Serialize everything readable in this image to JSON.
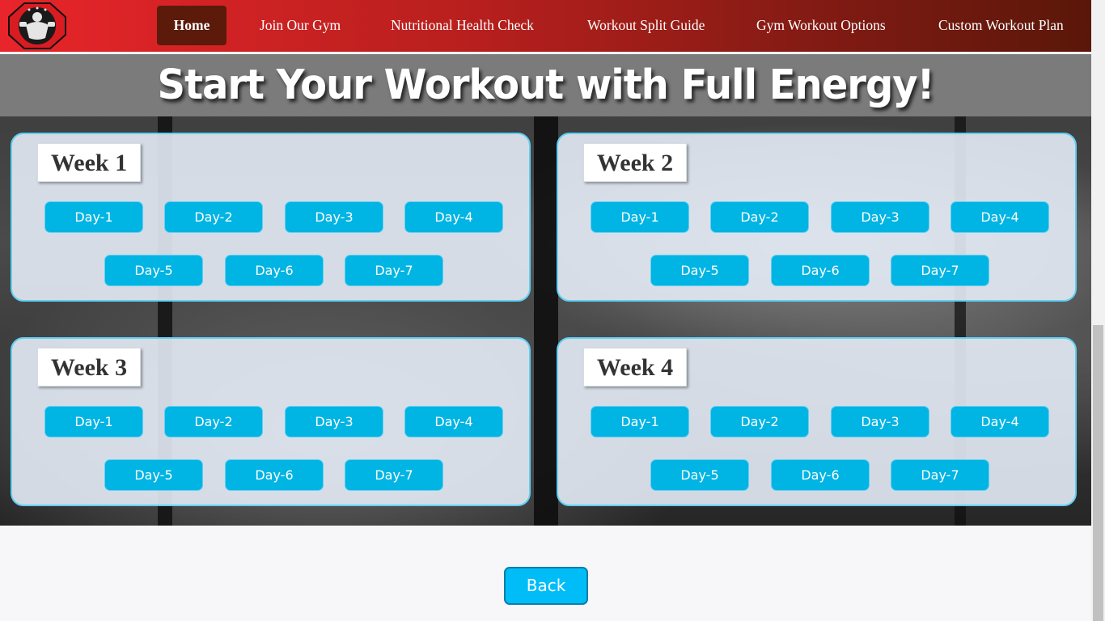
{
  "nav": {
    "logo": "gym-logo",
    "items": [
      {
        "label": "Home",
        "active": true
      },
      {
        "label": "Join Our Gym"
      },
      {
        "label": "Nutritional Health Check"
      },
      {
        "label": "Workout Split Guide"
      },
      {
        "label": "Gym Workout Options"
      },
      {
        "label": "Custom Workout Plan"
      }
    ]
  },
  "hero": {
    "title": "Start Your Workout with Full Energy!"
  },
  "weeks": [
    {
      "label": "Week 1",
      "days": [
        "Day-1",
        "Day-2",
        "Day-3",
        "Day-4",
        "Day-5",
        "Day-6",
        "Day-7"
      ]
    },
    {
      "label": "Week 2",
      "days": [
        "Day-1",
        "Day-2",
        "Day-3",
        "Day-4",
        "Day-5",
        "Day-6",
        "Day-7"
      ]
    },
    {
      "label": "Week 3",
      "days": [
        "Day-1",
        "Day-2",
        "Day-3",
        "Day-4",
        "Day-5",
        "Day-6",
        "Day-7"
      ]
    },
    {
      "label": "Week 4",
      "days": [
        "Day-1",
        "Day-2",
        "Day-3",
        "Day-4",
        "Day-5",
        "Day-6",
        "Day-7"
      ]
    }
  ],
  "back_label": "Back",
  "colors": {
    "nav_red": "#e8252a",
    "nav_dark": "#5a1709",
    "day_button": "#00b4e3",
    "card_border": "#5fd0f5",
    "back_button": "#00bdf8"
  }
}
